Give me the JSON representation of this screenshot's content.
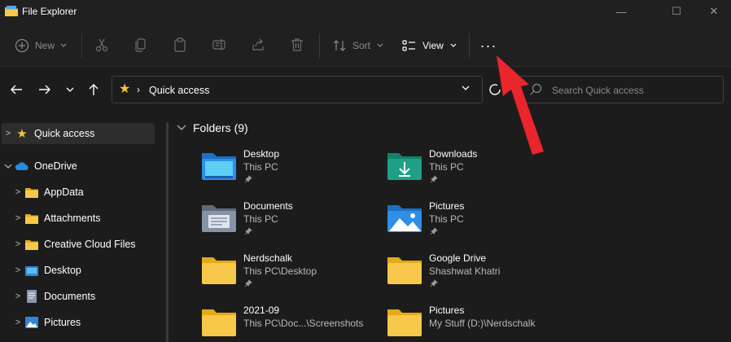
{
  "window": {
    "title": "File Explorer",
    "minimize_glyph": "—",
    "maximize_glyph": "☐",
    "close_glyph": "✕"
  },
  "toolbar": {
    "new_label": "New",
    "sort_label": "Sort",
    "view_label": "View",
    "more_glyph": "···"
  },
  "address": {
    "crumb_separator": "›",
    "location": "Quick access"
  },
  "search": {
    "placeholder": "Search Quick access"
  },
  "sidebar": {
    "items": [
      {
        "label": "Quick access",
        "icon": "star-icon"
      },
      {
        "label": "OneDrive",
        "icon": "cloud-icon"
      },
      {
        "label": "AppData",
        "icon": "folder-icon"
      },
      {
        "label": "Attachments",
        "icon": "folder-icon"
      },
      {
        "label": "Creative Cloud Files",
        "icon": "folder-icon"
      },
      {
        "label": "Desktop",
        "icon": "desktop-folder-icon"
      },
      {
        "label": "Documents",
        "icon": "documents-folder-icon"
      },
      {
        "label": "Pictures",
        "icon": "pictures-folder-icon"
      }
    ]
  },
  "main": {
    "section_title": "Folders (9)",
    "folders": [
      {
        "name": "Desktop",
        "location": "This PC",
        "pinned": true,
        "icon": "desktop-folder-icon"
      },
      {
        "name": "Downloads",
        "location": "This PC",
        "pinned": true,
        "icon": "downloads-folder-icon"
      },
      {
        "name": "Documents",
        "location": "This PC",
        "pinned": true,
        "icon": "documents-folder-icon"
      },
      {
        "name": "Pictures",
        "location": "This PC",
        "pinned": true,
        "icon": "pictures-folder-icon"
      },
      {
        "name": "Nerdschalk",
        "location": "This PC\\Desktop",
        "pinned": true,
        "icon": "folder-icon"
      },
      {
        "name": "Google Drive",
        "location": "Shashwat Khatri",
        "pinned": true,
        "icon": "folder-icon"
      },
      {
        "name": "2021-09",
        "location": "This PC\\Doc...\\Screenshots",
        "pinned": false,
        "icon": "folder-icon"
      },
      {
        "name": "Pictures",
        "location": "My Stuff (D:)\\Nerdschalk",
        "pinned": false,
        "icon": "folder-icon"
      }
    ]
  },
  "colors": {
    "background": "#1c1c1c",
    "chrome": "#202020",
    "folder_yellow": "#f8c84a",
    "star_yellow": "#f4c43a",
    "onedrive_blue": "#2a8ae0",
    "downloads_teal": "#1fa085",
    "annotation_red": "#e8262c"
  }
}
